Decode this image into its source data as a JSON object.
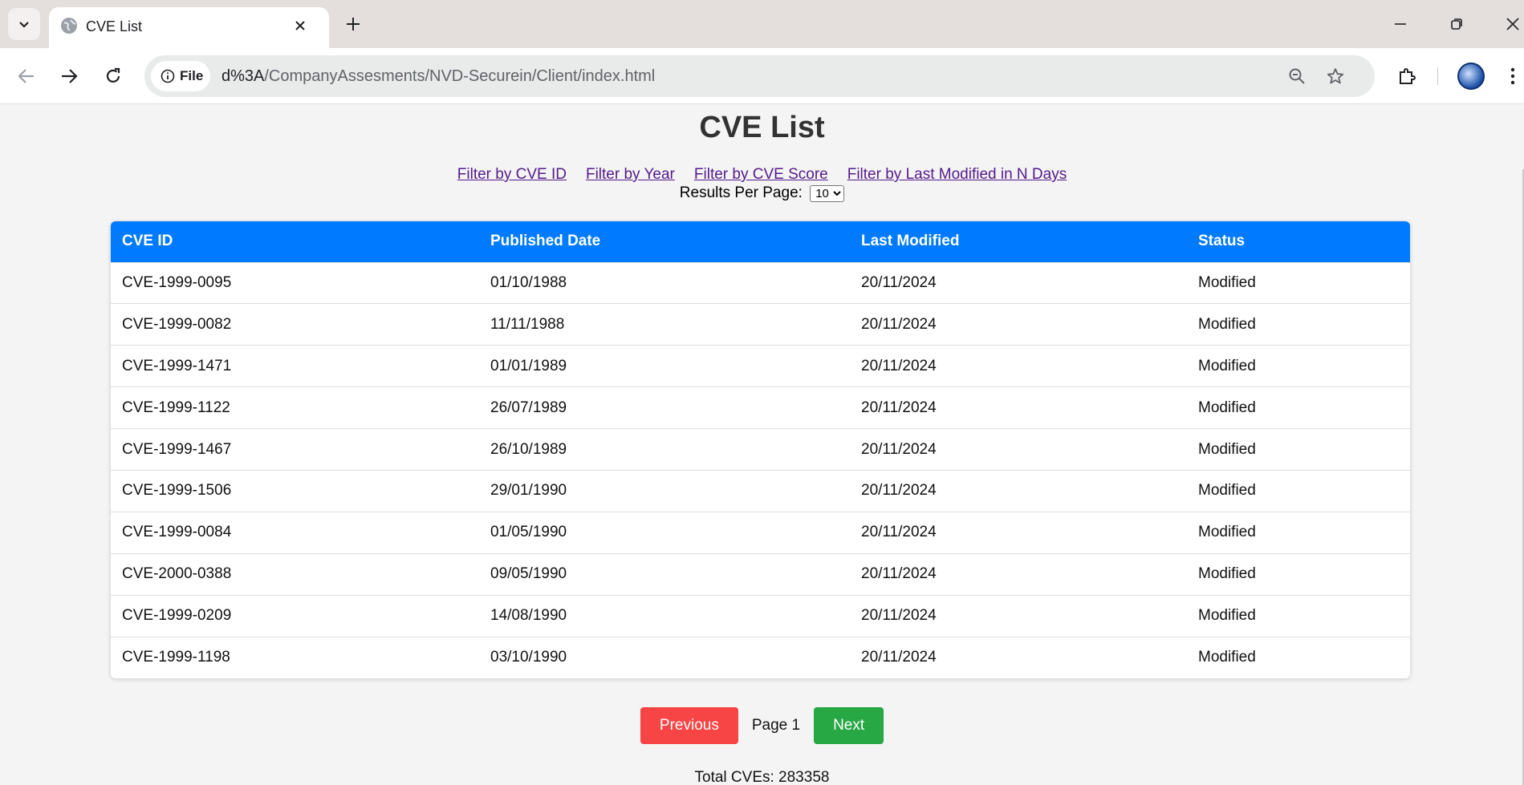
{
  "browser": {
    "tab_title": "CVE List",
    "file_chip": "File",
    "url_host": "d%3A",
    "url_path": "/CompanyAssesments/NVD-Securein/Client/index.html"
  },
  "page": {
    "title": "CVE List",
    "filters": [
      "Filter by CVE ID",
      "Filter by Year",
      "Filter by CVE Score",
      "Filter by Last Modified in N Days"
    ],
    "results_per_page_label": "Results Per Page:",
    "results_per_page_value": "10",
    "table": {
      "headers": [
        "CVE ID",
        "Published Date",
        "Last Modified",
        "Status"
      ],
      "rows": [
        [
          "CVE-1999-0095",
          "01/10/1988",
          "20/11/2024",
          "Modified"
        ],
        [
          "CVE-1999-0082",
          "11/11/1988",
          "20/11/2024",
          "Modified"
        ],
        [
          "CVE-1999-1471",
          "01/01/1989",
          "20/11/2024",
          "Modified"
        ],
        [
          "CVE-1999-1122",
          "26/07/1989",
          "20/11/2024",
          "Modified"
        ],
        [
          "CVE-1999-1467",
          "26/10/1989",
          "20/11/2024",
          "Modified"
        ],
        [
          "CVE-1999-1506",
          "29/01/1990",
          "20/11/2024",
          "Modified"
        ],
        [
          "CVE-1999-0084",
          "01/05/1990",
          "20/11/2024",
          "Modified"
        ],
        [
          "CVE-2000-0388",
          "09/05/1990",
          "20/11/2024",
          "Modified"
        ],
        [
          "CVE-1999-0209",
          "14/08/1990",
          "20/11/2024",
          "Modified"
        ],
        [
          "CVE-1999-1198",
          "03/10/1990",
          "20/11/2024",
          "Modified"
        ]
      ]
    },
    "pagination": {
      "previous_label": "Previous",
      "page_label": "Page 1",
      "next_label": "Next"
    },
    "total_label": "Total CVEs: 283358"
  },
  "colors": {
    "header_blue": "#007bff",
    "prev_red": "#f74444",
    "next_green": "#28a745",
    "link_purple": "#551a8b"
  },
  "icons": [
    "tab-list-icon",
    "globe-icon",
    "close-icon",
    "plus-icon",
    "minimize-icon",
    "restore-icon",
    "window-close-icon",
    "back-icon",
    "forward-icon",
    "reload-icon",
    "info-icon",
    "zoom-icon",
    "star-icon",
    "extensions-icon",
    "profile-avatar",
    "kebab-menu-icon"
  ]
}
